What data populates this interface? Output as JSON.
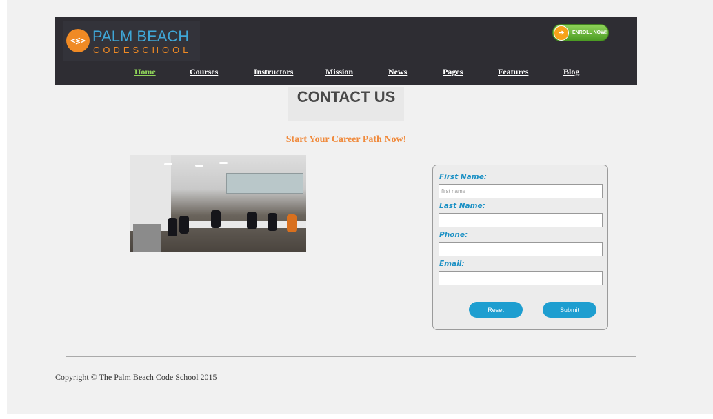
{
  "header": {
    "logo_top": "PALM BEACH",
    "logo_bottom": "CODESCHOOL",
    "logo_badge": "<≶>",
    "enroll_label": "ENROLL NOW!",
    "enroll_icon": "arrow-right-icon"
  },
  "nav": {
    "items": [
      {
        "label": "Home",
        "active": true
      },
      {
        "label": "Courses"
      },
      {
        "label": "Instructors"
      },
      {
        "label": "Mission"
      },
      {
        "label": "News"
      },
      {
        "label": "Pages"
      },
      {
        "label": "Features"
      },
      {
        "label": "Blog"
      }
    ]
  },
  "main": {
    "title": "CONTACT US",
    "tagline": "Start Your Career Path Now!"
  },
  "form": {
    "first_name_label": "First Name:",
    "first_name_placeholder": "first name",
    "last_name_label": "Last Name:",
    "phone_label": "Phone:",
    "email_label": "Email:",
    "reset_label": "Reset",
    "submit_label": "Submit"
  },
  "footer": {
    "copyright": "Copyright © The Palm Beach Code School 2015"
  },
  "colors": {
    "header_bg": "#2e2d33",
    "nav_active": "#8fd35a",
    "accent_orange": "#f08a3c",
    "accent_blue": "#1e9ed0",
    "form_label": "#1b90c4"
  }
}
